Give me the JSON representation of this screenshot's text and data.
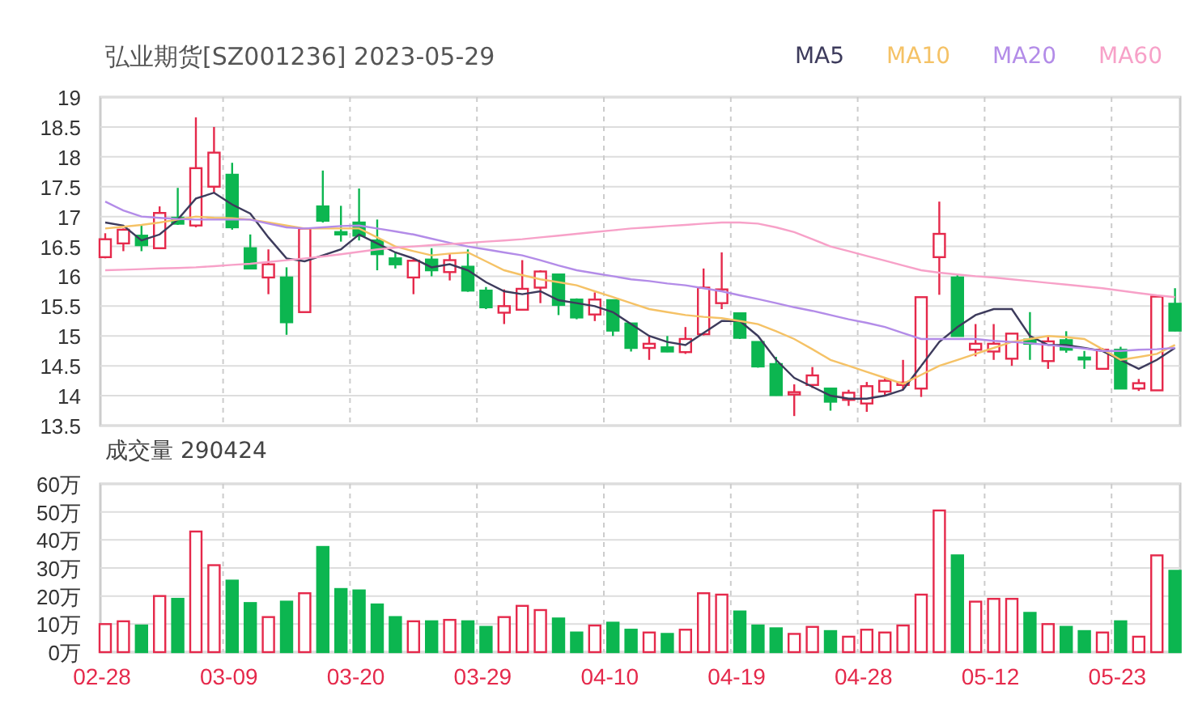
{
  "title": "弘业期货[SZ001236] 2023-05-29",
  "price_chart": {
    "chart_data": {
      "type": "candlestick",
      "grid": true,
      "ylim": [
        13.5,
        19
      ],
      "yticks": [
        13.5,
        14,
        14.5,
        15,
        15.5,
        16,
        16.5,
        17,
        17.5,
        18,
        18.5,
        19
      ],
      "ohlc": [
        [
          16.32,
          16.72,
          16.3,
          16.62
        ],
        [
          16.55,
          16.8,
          16.42,
          16.78
        ],
        [
          16.68,
          16.86,
          16.42,
          16.52
        ],
        [
          16.47,
          17.17,
          16.47,
          17.06
        ],
        [
          16.98,
          17.48,
          16.86,
          16.88
        ],
        [
          16.85,
          18.66,
          16.82,
          17.81
        ],
        [
          17.5,
          18.5,
          17.4,
          18.07
        ],
        [
          17.7,
          17.9,
          16.78,
          16.82
        ],
        [
          16.47,
          16.7,
          16.13,
          16.13
        ],
        [
          15.98,
          16.45,
          15.7,
          16.2
        ],
        [
          15.98,
          16.15,
          15.02,
          15.23
        ],
        [
          15.4,
          16.8,
          15.4,
          16.8
        ],
        [
          17.17,
          17.77,
          16.9,
          16.93
        ],
        [
          16.74,
          17.18,
          16.58,
          16.7
        ],
        [
          16.9,
          17.47,
          16.6,
          16.68
        ],
        [
          16.6,
          16.95,
          16.1,
          16.37
        ],
        [
          16.3,
          16.4,
          16.13,
          16.2
        ],
        [
          15.98,
          16.3,
          15.7,
          16.26
        ],
        [
          16.28,
          16.47,
          16.0,
          16.1
        ],
        [
          16.07,
          16.37,
          15.93,
          16.27
        ],
        [
          16.16,
          16.45,
          15.74,
          15.76
        ],
        [
          15.76,
          15.82,
          15.45,
          15.48
        ],
        [
          15.39,
          15.78,
          15.2,
          15.5
        ],
        [
          15.44,
          16.27,
          15.43,
          15.79
        ],
        [
          15.81,
          16.1,
          15.55,
          16.08
        ],
        [
          16.03,
          16.03,
          15.35,
          15.52
        ],
        [
          15.61,
          15.63,
          15.28,
          15.31
        ],
        [
          15.36,
          15.73,
          15.25,
          15.61
        ],
        [
          15.6,
          15.6,
          15.0,
          15.09
        ],
        [
          15.21,
          15.21,
          14.74,
          14.8
        ],
        [
          14.8,
          15.0,
          14.6,
          14.87
        ],
        [
          14.81,
          15.0,
          14.73,
          14.74
        ],
        [
          14.73,
          15.15,
          14.7,
          14.95
        ],
        [
          15.03,
          16.13,
          15.01,
          15.81
        ],
        [
          15.55,
          16.4,
          15.45,
          15.78
        ],
        [
          15.38,
          15.38,
          14.95,
          14.97
        ],
        [
          14.9,
          14.9,
          14.47,
          14.49
        ],
        [
          14.53,
          14.65,
          14.0,
          14.01
        ],
        [
          14.02,
          14.19,
          13.66,
          14.06
        ],
        [
          14.18,
          14.48,
          14.13,
          14.34
        ],
        [
          14.12,
          14.12,
          13.75,
          13.9
        ],
        [
          13.93,
          14.1,
          13.83,
          14.05
        ],
        [
          13.87,
          14.23,
          13.73,
          14.16
        ],
        [
          14.07,
          14.3,
          14.0,
          14.25
        ],
        [
          14.18,
          14.6,
          14.1,
          14.22
        ],
        [
          14.12,
          15.65,
          13.98,
          15.65
        ],
        [
          16.32,
          17.25,
          15.69,
          16.71
        ],
        [
          15.98,
          16.03,
          15.0,
          15.0
        ],
        [
          14.77,
          15.2,
          14.66,
          14.87
        ],
        [
          14.74,
          15.2,
          14.6,
          14.87
        ],
        [
          14.62,
          15.04,
          14.5,
          15.04
        ],
        [
          14.94,
          15.4,
          14.6,
          14.87
        ],
        [
          14.58,
          15.0,
          14.45,
          14.91
        ],
        [
          14.93,
          15.08,
          14.72,
          14.77
        ],
        [
          14.64,
          14.75,
          14.45,
          14.62
        ],
        [
          14.45,
          14.8,
          14.45,
          14.77
        ],
        [
          14.77,
          14.82,
          14.12,
          14.12
        ],
        [
          14.12,
          14.28,
          14.08,
          14.21
        ],
        [
          14.09,
          15.66,
          14.09,
          15.66
        ],
        [
          15.54,
          15.8,
          15.08,
          15.09
        ]
      ]
    }
  },
  "moving_averages": {
    "chart_data": {
      "type": "line",
      "ylim": [
        13.5,
        19
      ],
      "series": [
        {
          "name": "MA5",
          "color": "#3d3b5c",
          "values": [
            16.9,
            16.85,
            16.6,
            16.7,
            16.95,
            17.3,
            17.4,
            17.2,
            17.05,
            16.65,
            16.3,
            16.25,
            16.35,
            16.45,
            16.7,
            16.55,
            16.4,
            16.3,
            16.15,
            16.2,
            16.1,
            15.9,
            15.75,
            15.7,
            15.75,
            15.6,
            15.55,
            15.5,
            15.4,
            15.2,
            15.0,
            14.9,
            14.85,
            15.05,
            15.25,
            15.25,
            15.0,
            14.6,
            14.3,
            14.15,
            14.0,
            13.95,
            13.95,
            14.0,
            14.1,
            14.5,
            14.9,
            15.15,
            15.35,
            15.45,
            15.45,
            15.0,
            14.85,
            14.85,
            14.8,
            14.75,
            14.6,
            14.45,
            14.6,
            14.8
          ]
        },
        {
          "name": "MA10",
          "color": "#f5c266",
          "values": [
            16.8,
            16.83,
            16.86,
            16.9,
            16.95,
            17.0,
            16.98,
            16.97,
            16.95,
            16.9,
            16.85,
            16.8,
            16.8,
            16.8,
            16.8,
            16.65,
            16.5,
            16.42,
            16.35,
            16.38,
            16.4,
            16.25,
            16.1,
            16.02,
            15.95,
            15.9,
            15.85,
            15.75,
            15.65,
            15.55,
            15.45,
            15.4,
            15.35,
            15.32,
            15.3,
            15.25,
            15.2,
            15.08,
            14.95,
            14.78,
            14.6,
            14.5,
            14.4,
            14.3,
            14.2,
            14.35,
            14.5,
            14.6,
            14.7,
            14.8,
            14.9,
            14.95,
            15.0,
            14.98,
            14.95,
            14.78,
            14.6,
            14.65,
            14.7,
            14.85
          ]
        },
        {
          "name": "MA20",
          "color": "#b38ce8",
          "values": [
            17.25,
            17.1,
            17.0,
            16.98,
            16.96,
            16.95,
            16.95,
            16.95,
            16.95,
            16.88,
            16.82,
            16.8,
            16.82,
            16.84,
            16.85,
            16.8,
            16.75,
            16.7,
            16.63,
            16.56,
            16.5,
            16.45,
            16.4,
            16.35,
            16.27,
            16.18,
            16.1,
            16.05,
            16.0,
            15.95,
            15.92,
            15.88,
            15.85,
            15.8,
            15.75,
            15.68,
            15.62,
            15.55,
            15.48,
            15.42,
            15.35,
            15.28,
            15.22,
            15.15,
            15.05,
            14.95,
            14.95,
            14.95,
            14.95,
            14.92,
            14.9,
            14.88,
            14.85,
            14.82,
            14.79,
            14.75,
            14.75,
            14.77,
            14.78,
            14.8
          ]
        },
        {
          "name": "MA60",
          "color": "#f7a1c8",
          "values": [
            16.1,
            16.11,
            16.12,
            16.13,
            16.14,
            16.15,
            16.17,
            16.19,
            16.21,
            16.24,
            16.27,
            16.3,
            16.33,
            16.37,
            16.41,
            16.45,
            16.48,
            16.5,
            16.52,
            16.54,
            16.56,
            16.58,
            16.6,
            16.62,
            16.65,
            16.68,
            16.71,
            16.74,
            16.77,
            16.8,
            16.82,
            16.84,
            16.86,
            16.88,
            16.9,
            16.9,
            16.88,
            16.82,
            16.74,
            16.62,
            16.5,
            16.42,
            16.34,
            16.26,
            16.18,
            16.1,
            16.06,
            16.03,
            16.0,
            15.98,
            15.95,
            15.92,
            15.89,
            15.86,
            15.83,
            15.8,
            15.76,
            15.72,
            15.68,
            15.65
          ]
        }
      ]
    }
  },
  "volume_chart": {
    "title": "成交量 290424",
    "chart_data": {
      "type": "bar",
      "grid": true,
      "ylim": [
        0,
        60
      ],
      "categories": [
        "02-28",
        null,
        null,
        null,
        null,
        null,
        null,
        "03-09",
        null,
        null,
        null,
        null,
        null,
        null,
        "03-20",
        null,
        null,
        null,
        null,
        null,
        null,
        "03-29",
        null,
        null,
        null,
        null,
        null,
        null,
        "04-10",
        null,
        null,
        null,
        null,
        null,
        null,
        "04-19",
        null,
        null,
        null,
        null,
        null,
        null,
        "04-28",
        null,
        null,
        null,
        null,
        null,
        null,
        "05-12",
        null,
        null,
        null,
        null,
        null,
        null,
        "05-23",
        null,
        null,
        null
      ],
      "yticks": [
        {
          "value": 0,
          "label": "0万"
        },
        {
          "value": 10,
          "label": "10万"
        },
        {
          "value": 20,
          "label": "20万"
        },
        {
          "value": 30,
          "label": "30万"
        },
        {
          "value": 40,
          "label": "40万"
        },
        {
          "value": 50,
          "label": "50万"
        },
        {
          "value": 60,
          "label": "60万"
        }
      ],
      "values": [
        10,
        11,
        9.5,
        20,
        19,
        43,
        31,
        25.5,
        17.5,
        12.5,
        18,
        21,
        37.5,
        22.5,
        22,
        17,
        12.5,
        11,
        11,
        11.5,
        11,
        9,
        12.5,
        16.5,
        15,
        12,
        7,
        9.5,
        10.5,
        8,
        7,
        6.5,
        8,
        21,
        20.5,
        14.5,
        9.5,
        8.5,
        6.5,
        9,
        7.5,
        5.5,
        8,
        7,
        9.5,
        20.5,
        50.5,
        34.5,
        18,
        19,
        19,
        14,
        10,
        9,
        7.5,
        7,
        11,
        5.5,
        34.5,
        29
      ]
    }
  }
}
